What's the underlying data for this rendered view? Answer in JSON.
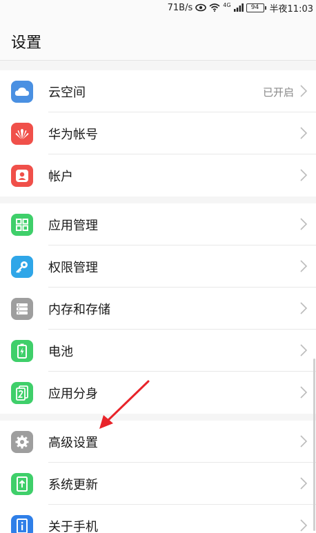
{
  "status_bar": {
    "speed": "71B/s",
    "network": "4G",
    "battery": "94",
    "time": "半夜11:03"
  },
  "header": {
    "title": "设置"
  },
  "groups": [
    {
      "items": [
        {
          "label": "云空间",
          "value": "已开启",
          "icon": "cloud-icon",
          "color": "#4a90e2"
        },
        {
          "label": "华为帐号",
          "icon": "huawei-logo-icon",
          "color": "#f0504a"
        },
        {
          "label": "帐户",
          "icon": "account-icon",
          "color": "#f0504a"
        }
      ]
    },
    {
      "items": [
        {
          "label": "应用管理",
          "icon": "apps-grid-icon",
          "color": "#3fcf6a"
        },
        {
          "label": "权限管理",
          "icon": "key-icon",
          "color": "#2fa6e8"
        },
        {
          "label": "内存和存储",
          "icon": "storage-icon",
          "color": "#9e9e9e"
        },
        {
          "label": "电池",
          "icon": "battery-icon",
          "color": "#3fcf6a"
        },
        {
          "label": "应用分身",
          "icon": "app-twin-icon",
          "color": "#3fcf6a"
        }
      ]
    },
    {
      "items": [
        {
          "label": "高级设置",
          "icon": "gear-icon",
          "color": "#9e9e9e"
        },
        {
          "label": "系统更新",
          "icon": "system-update-icon",
          "color": "#3fcf6a"
        },
        {
          "label": "关于手机",
          "icon": "phone-info-icon",
          "color": "#2f7fe8"
        }
      ]
    }
  ]
}
